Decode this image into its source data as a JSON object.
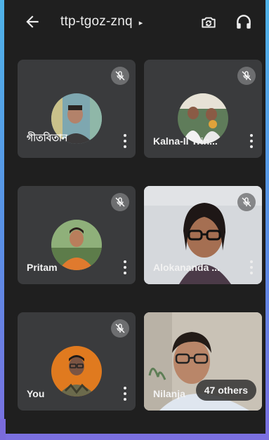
{
  "header": {
    "meeting_code": "ttp-tgoz-znq",
    "caret": "▸"
  },
  "participants": [
    {
      "name": "গীতবিতান",
      "muted": true,
      "type": "avatar"
    },
    {
      "name": "Kalna-II Trin...",
      "muted": true,
      "type": "avatar"
    },
    {
      "name": "Pritam",
      "muted": true,
      "type": "avatar"
    },
    {
      "name": "Alokananda ...",
      "muted": true,
      "type": "video"
    },
    {
      "name": "You",
      "muted": true,
      "type": "avatar"
    },
    {
      "name": "Nilanja",
      "muted": false,
      "type": "video"
    }
  ],
  "overflow": {
    "label": "47 others"
  },
  "colors": {
    "tile_bg": "#3a3b3d",
    "screen_bg": "#1f1f1f",
    "mic_badge": "#6d6e70"
  }
}
